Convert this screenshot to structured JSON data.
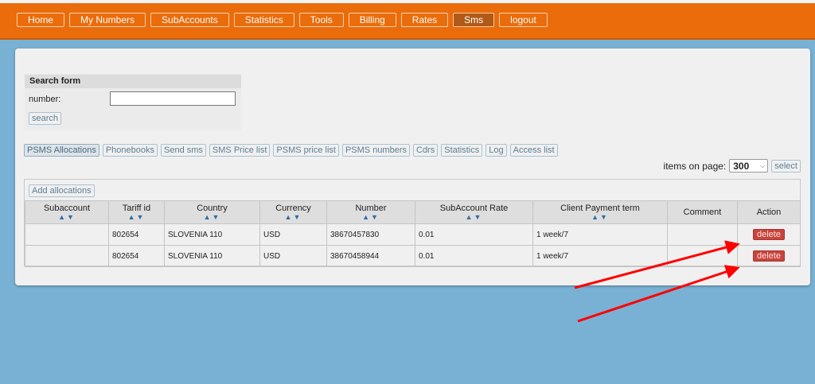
{
  "nav": {
    "items": [
      "Home",
      "My Numbers",
      "SubAccounts",
      "Statistics",
      "Tools",
      "Billing",
      "Rates",
      "Sms",
      "logout"
    ],
    "active": "Sms"
  },
  "search_form": {
    "title": "Search form",
    "number_label": "number:",
    "number_value": "",
    "search_label": "search"
  },
  "subtabs": {
    "items": [
      "PSMS Allocations",
      "Phonebooks",
      "Send sms",
      "SMS Price list",
      "PSMS price list",
      "PSMS numbers",
      "Cdrs",
      "Statistics",
      "Log",
      "Access list"
    ],
    "active": "PSMS Allocations"
  },
  "pagination": {
    "label": "items on page:",
    "value": "300",
    "select_label": "select"
  },
  "table": {
    "add_label": "Add allocations",
    "columns": [
      {
        "label": "Subaccount",
        "sortable": true
      },
      {
        "label": "Tariff id",
        "sortable": true
      },
      {
        "label": "Country",
        "sortable": true
      },
      {
        "label": "Currency",
        "sortable": true
      },
      {
        "label": "Number",
        "sortable": true
      },
      {
        "label": "SubAccount Rate",
        "sortable": true
      },
      {
        "label": "Client Payment term",
        "sortable": true
      },
      {
        "label": "Comment",
        "sortable": false
      },
      {
        "label": "Action",
        "sortable": false
      }
    ],
    "sort_arrows": "▲▼",
    "delete_label": "delete",
    "rows": [
      {
        "subaccount": "",
        "tariff_id": "802654",
        "country": "SLOVENIA 110",
        "currency": "USD",
        "number": "38670457830",
        "rate": "0.01",
        "payment_term": "1 week/7",
        "comment": ""
      },
      {
        "subaccount": "",
        "tariff_id": "802654",
        "country": "SLOVENIA 110",
        "currency": "USD",
        "number": "38670458944",
        "rate": "0.01",
        "payment_term": "1 week/7",
        "comment": ""
      }
    ]
  },
  "colors": {
    "topbar": "#ea6c0b",
    "page_bg": "#79b1d4",
    "delete_btn": "#c8443c",
    "annotation": "#ff0000",
    "sort_arrow": "#2f6da3"
  }
}
